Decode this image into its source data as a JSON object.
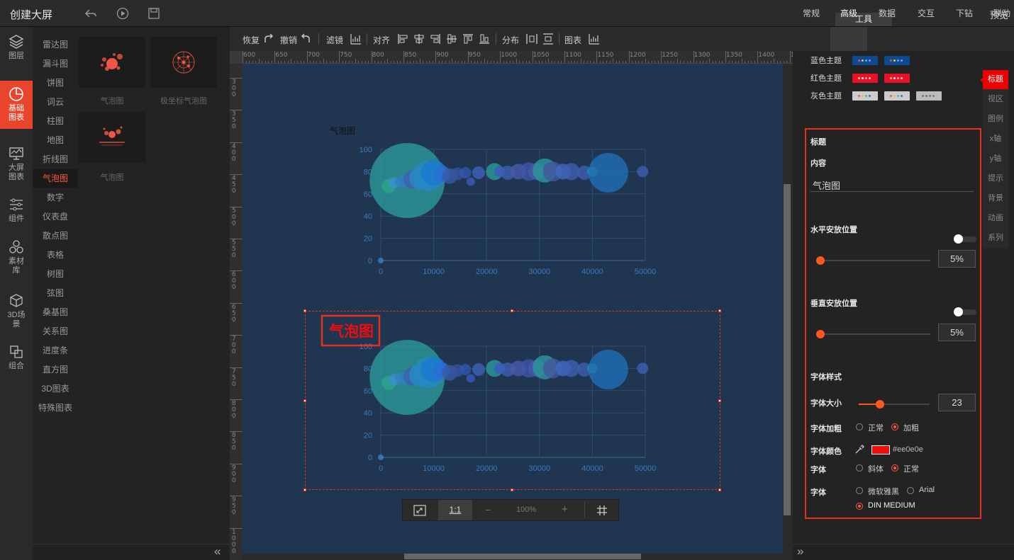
{
  "app": {
    "title": "创建大屏",
    "preview_label": "预览",
    "tools_tab": "工具"
  },
  "leftnav": {
    "items": [
      {
        "label": "图层",
        "icon": "layers-icon"
      },
      {
        "label": "基础图表",
        "icon": "pie-chart-icon",
        "active": true
      },
      {
        "label": "大屏图表",
        "icon": "monitor-chart-icon"
      },
      {
        "label": "组件",
        "icon": "sliders-icon"
      },
      {
        "label": "素材库",
        "icon": "hexagons-icon"
      },
      {
        "label": "3D场景",
        "icon": "cube-icon"
      },
      {
        "label": "组合",
        "icon": "combine-icon"
      }
    ]
  },
  "categories": [
    "雷达图",
    "漏斗图",
    "饼图",
    "词云",
    "柱图",
    "地图",
    "折线图",
    "气泡图",
    "数字",
    "仪表盘",
    "散点图",
    "表格",
    "树图",
    "弦图",
    "桑基图",
    "关系图",
    "进度条",
    "直方图",
    "3D图表",
    "特殊图表"
  ],
  "active_category": "气泡图",
  "thumbs": [
    {
      "label": "气泡图"
    },
    {
      "label": "极坐标气泡图"
    },
    {
      "label": "气泡图"
    }
  ],
  "toolbar": {
    "redo": "恢复",
    "undo": "撤销",
    "filter": "滤镜",
    "align": "对齐",
    "distribute": "分布",
    "chart": "图表"
  },
  "ruler_h": [
    "600",
    "650",
    "700",
    "750",
    "800",
    "850",
    "900",
    "950",
    "1000",
    "1050",
    "1100",
    "1150",
    "1200",
    "1250",
    "1300",
    "1350",
    "1400",
    "145"
  ],
  "ruler_v": [
    "300",
    "350",
    "400",
    "450",
    "500",
    "550",
    "600",
    "650",
    "700",
    "750",
    "800",
    "850",
    "900",
    "950",
    "1000"
  ],
  "chart_data": [
    {
      "type": "scatter",
      "title": "气泡图",
      "xlim": [
        0,
        50000
      ],
      "ylim": [
        0,
        100
      ],
      "x_ticks": [
        "0",
        "10000",
        "20000",
        "30000",
        "40000",
        "50000"
      ],
      "y_ticks": [
        "0",
        "20",
        "40",
        "60",
        "80",
        "100"
      ]
    },
    {
      "type": "scatter",
      "title": "气泡图",
      "xlim": [
        0,
        50000
      ],
      "ylim": [
        0,
        100
      ],
      "x_ticks": [
        "0",
        "10000",
        "20000",
        "30000",
        "40000",
        "50000"
      ],
      "y_ticks": [
        "0",
        "20",
        "40",
        "60",
        "80",
        "100"
      ]
    }
  ],
  "bubbles": [
    {
      "x": 5000,
      "y": 72,
      "r": 53,
      "c": "#2a9a9a"
    },
    {
      "x": 1500,
      "y": 67,
      "r": 10,
      "c": "#2aa58a"
    },
    {
      "x": 2500,
      "y": 70,
      "r": 8,
      "c": "#3a8fd0"
    },
    {
      "x": 4000,
      "y": 71,
      "r": 9,
      "c": "#2f7fc0"
    },
    {
      "x": 6000,
      "y": 73,
      "r": 13,
      "c": "#3f5fb0"
    },
    {
      "x": 7500,
      "y": 74,
      "r": 16,
      "c": "#2a8ac8"
    },
    {
      "x": 9000,
      "y": 76,
      "r": 22,
      "c": "#2488c0"
    },
    {
      "x": 10000,
      "y": 79,
      "r": 18,
      "c": "#1a7ad0"
    },
    {
      "x": 11500,
      "y": 78,
      "r": 12,
      "c": "#2a6ed6"
    },
    {
      "x": 13000,
      "y": 76,
      "r": 11,
      "c": "#3a5aa8"
    },
    {
      "x": 14500,
      "y": 78,
      "r": 9,
      "c": "#3b52a0"
    },
    {
      "x": 16000,
      "y": 79,
      "r": 8,
      "c": "#3058b0"
    },
    {
      "x": 17000,
      "y": 71,
      "r": 6,
      "c": "#3a5ac0"
    },
    {
      "x": 18500,
      "y": 79,
      "r": 9,
      "c": "#3f62b8"
    },
    {
      "x": 21500,
      "y": 80,
      "r": 12,
      "c": "#2a9a9a"
    },
    {
      "x": 22500,
      "y": 80,
      "r": 8,
      "c": "#3a5ac0"
    },
    {
      "x": 24000,
      "y": 79,
      "r": 10,
      "c": "#3f5fb0"
    },
    {
      "x": 26000,
      "y": 80,
      "r": 11,
      "c": "#4a5aa8"
    },
    {
      "x": 28000,
      "y": 80,
      "r": 13,
      "c": "#3f55a8"
    },
    {
      "x": 29500,
      "y": 80,
      "r": 12,
      "c": "#475aa8"
    },
    {
      "x": 31000,
      "y": 81,
      "r": 17,
      "c": "#2a9a9a"
    },
    {
      "x": 32500,
      "y": 80,
      "r": 14,
      "c": "#4656a0"
    },
    {
      "x": 34500,
      "y": 80,
      "r": 11,
      "c": "#3f6ac0"
    },
    {
      "x": 36000,
      "y": 80,
      "r": 12,
      "c": "#3f5fb0"
    },
    {
      "x": 38500,
      "y": 79,
      "r": 10,
      "c": "#3f5fb0"
    },
    {
      "x": 40000,
      "y": 80,
      "r": 7,
      "c": "#2a9a9a"
    },
    {
      "x": 43000,
      "y": 79,
      "r": 28,
      "c": "#1f6fb8"
    },
    {
      "x": 49500,
      "y": 80,
      "r": 8,
      "c": "#3f5fb0"
    },
    {
      "x": 0,
      "y": 0,
      "r": 4,
      "c": "#3a7fd0"
    }
  ],
  "right": {
    "tabs": [
      "常规",
      "高级",
      "数据",
      "交互",
      "下钻",
      "联动"
    ],
    "active_tab": "高级",
    "themes": [
      {
        "label": "蓝色主题",
        "bg": "#0d4a8f",
        "dots": [
          "#e05050",
          "#f0c030",
          "#30c0e0",
          "#9090ff"
        ]
      },
      {
        "label": "红色主题",
        "bg": "#e8102a",
        "dots": [
          "#ffd040",
          "#ffffff",
          "#ffa0a0",
          "#ffe080"
        ]
      },
      {
        "label": "灰色主题",
        "bg": "#cccccc",
        "dots": [
          "#e06060",
          "#f0c040",
          "#40c0a0",
          "#6060c0"
        ]
      }
    ],
    "side_tabs": [
      "标题",
      "视区",
      "图例",
      "x轴",
      "y轴",
      "提示",
      "背景",
      "动画",
      "系列"
    ],
    "active_side_tab": "标题",
    "section_title": "标题",
    "content_label": "内容",
    "content_value": "气泡图",
    "h_pos_label": "水平安放位置",
    "h_pos_value": "5%",
    "v_pos_label": "垂直安放位置",
    "v_pos_value": "5%",
    "font_style_label": "字体样式",
    "font_size_label": "字体大小",
    "font_size_value": "23",
    "bold_label": "字体加粗",
    "bold_normal": "正常",
    "bold_bold": "加粗",
    "color_label": "字体颜色",
    "color_value": "#ee0e0e",
    "italic_label": "字体",
    "italic_italic": "斜体",
    "italic_normal": "正常",
    "family_label": "字体",
    "family_options": [
      "微软雅黑",
      "Arial",
      "DIN MEDIUM"
    ],
    "family_selected": "DIN MEDIUM"
  },
  "zoom": {
    "fit": "1:1",
    "minus": "−",
    "value": "100%",
    "plus": "+"
  }
}
